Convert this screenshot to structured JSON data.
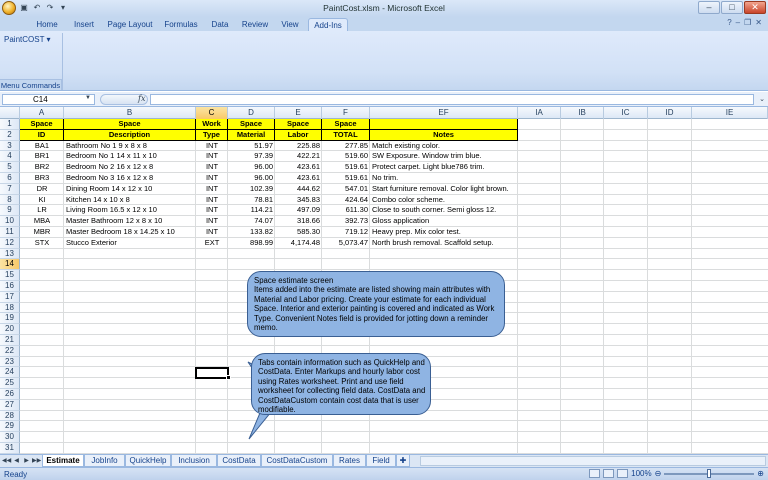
{
  "window": {
    "title": "PaintCost.xlsm - Microsoft Excel"
  },
  "ribbon": {
    "tabs": [
      "Home",
      "Insert",
      "Page Layout",
      "Formulas",
      "Data",
      "Review",
      "View",
      "Add-Ins"
    ],
    "active_tab": "Add-Ins",
    "addin_button": "PaintCOST ▾",
    "group_label": "Menu Commands"
  },
  "formula_bar": {
    "name_box": "C14",
    "fx": "fx",
    "formula": ""
  },
  "columns": [
    "A",
    "B",
    "C",
    "D",
    "E",
    "F",
    "EF",
    "IA",
    "IB",
    "IC",
    "ID",
    "IE"
  ],
  "selected_column": "C",
  "rows": [
    "1",
    "2",
    "3",
    "4",
    "5",
    "6",
    "7",
    "8",
    "9",
    "10",
    "11",
    "12",
    "13",
    "14",
    "15",
    "16",
    "17",
    "18",
    "19",
    "20",
    "21",
    "22",
    "23",
    "24",
    "25",
    "26",
    "27",
    "28",
    "29",
    "30",
    "31"
  ],
  "selected_row": "14",
  "header_row1": [
    "Space",
    "Space",
    "Work",
    "Space",
    "Space",
    "Space",
    ""
  ],
  "header_row2": [
    "ID",
    "Description",
    "Type",
    "Material",
    "Labor",
    "TOTAL",
    "Notes"
  ],
  "table": [
    [
      "BA1",
      "Bathroom No 1  9 x 8 x 8",
      "INT",
      "51.97",
      "225.88",
      "277.85",
      "Match existing color."
    ],
    [
      "BR1",
      "Bedroom No 1 14 x 11 x 10",
      "INT",
      "97.39",
      "422.21",
      "519.60",
      "SW Exposure. Window trim blue."
    ],
    [
      "BR2",
      "Bedroom No 2  16 x 12 x 8",
      "INT",
      "96.00",
      "423.61",
      "519.61",
      "Protect carpet. Light blue786 trim."
    ],
    [
      "BR3",
      "Bedroom No 3  16 x 12 x 8",
      "INT",
      "96.00",
      "423.61",
      "519.61",
      "No trim."
    ],
    [
      "DR",
      "Dining Room  14 x 12 x 10",
      "INT",
      "102.39",
      "444.62",
      "547.01",
      "Start furniture removal. Color light brown."
    ],
    [
      "KI",
      "Kitchen  14 x 10 x 8",
      "INT",
      "78.81",
      "345.83",
      "424.64",
      "Combo color scheme."
    ],
    [
      "LR",
      "Living Room  16.5 x 12 x 10",
      "INT",
      "114.21",
      "497.09",
      "611.30",
      "Close to south corner. Semi gloss 12."
    ],
    [
      "MBA",
      "Master Bathroom  12 x 8 x 10",
      "INT",
      "74.07",
      "318.66",
      "392.73",
      "Gloss application"
    ],
    [
      "MBR",
      "Master Bedroom  18 x 14.25 x 10",
      "INT",
      "133.82",
      "585.30",
      "719.12",
      "Heavy prep. Mix color test."
    ],
    [
      "STX",
      "Stucco Exterior",
      "EXT",
      "898.99",
      "4,174.48",
      "5,073.47",
      "North brush removal. Scaffold setup."
    ]
  ],
  "callouts": {
    "first": "Space estimate screen\nItems added into the estimate are listed showing main attributes with Material and Labor pricing. Create your estimate for each individual Space. Interior and exterior painting is covered and indicated as Work Type. Convenient Notes field is provided for jotting down a reminder memo.",
    "second": "Tabs contain information such as QuickHelp and CostData. Enter Markups and hourly labor cost using Rates worksheet. Print and use field worksheet for collecting field data. CostData and CostDataCustom contain cost data that is user modifiable."
  },
  "sheet_tabs": [
    "Estimate",
    "JobInfo",
    "QuickHelp",
    "Inclusion",
    "CostData",
    "CostDataCustom",
    "Rates",
    "Field"
  ],
  "active_sheet": "Estimate",
  "status": {
    "text": "Ready",
    "zoom": "100%"
  },
  "colors": {
    "header_fill": "#ffff00",
    "callout_fill": "#8fb4e3",
    "accent": "#15428b"
  }
}
